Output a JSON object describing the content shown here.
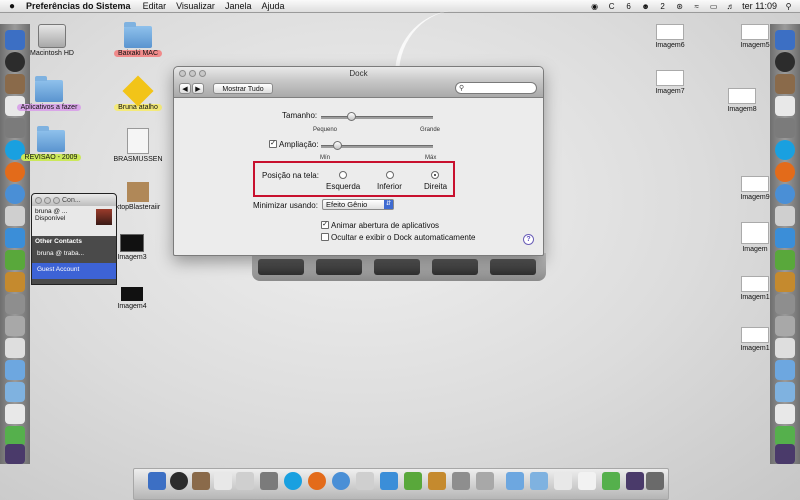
{
  "menubar": {
    "apple": "",
    "app_name": "Preferências do Sistema",
    "items": [
      "Editar",
      "Visualizar",
      "Janela",
      "Ajuda"
    ],
    "tray": {
      "badge1": "6",
      "badge2": "2",
      "clock": "ter 11:09"
    }
  },
  "desktop": {
    "left_items": [
      {
        "label": "Macintosh HD"
      },
      {
        "label": "Baixaki MAC"
      },
      {
        "label": "Aplicativos a fazer"
      },
      {
        "label": "Bruna atalho"
      },
      {
        "label": "REVISAO - 2009"
      },
      {
        "label": "BRASMUSSEN"
      },
      {
        "label": "ktopBlasteraiir"
      },
      {
        "label": "Imagem3"
      },
      {
        "label": "Imagem4"
      }
    ],
    "right_items": [
      {
        "label": "Imagem6"
      },
      {
        "label": "Imagem7"
      },
      {
        "label": "Imagem8"
      },
      {
        "label": "Imagem5"
      },
      {
        "label": "Imagem9"
      },
      {
        "label": "Imagem"
      },
      {
        "label": "Imagem1"
      },
      {
        "label": "Imagem1"
      }
    ],
    "colors": {
      "accent_red": "#c8102e",
      "selection_blue": "#3d63d6"
    }
  },
  "chat": {
    "title": "Con...",
    "me_name": "bruna @ ...",
    "me_status": "Disponível",
    "group": "Other Contacts",
    "contacts": [
      "bruna @ traba...",
      "Guest Account"
    ]
  },
  "window": {
    "title": "Dock",
    "show_all": "Mostrar Tudo",
    "search": {
      "value": "",
      "placeholder": ""
    },
    "size": {
      "label": "Tamanho:",
      "min": "Pequeno",
      "max": "Grande",
      "value_fraction": 0.25
    },
    "magnification": {
      "label": "Ampliação:",
      "checked": true,
      "min": "Mín",
      "max": "Máx",
      "value_fraction": 0.12
    },
    "position": {
      "label": "Posição na tela:",
      "options": [
        "Esquerda",
        "Inferior",
        "Direita"
      ],
      "selected": "Direita"
    },
    "minimize": {
      "label": "Minimizar usando:",
      "value": "Efeito Gênio"
    },
    "animate": {
      "label": "Animar abertura de aplicativos",
      "checked": true
    },
    "autohide": {
      "label": "Ocultar e exibir o Dock automaticamente",
      "checked": false
    },
    "help": "?"
  }
}
